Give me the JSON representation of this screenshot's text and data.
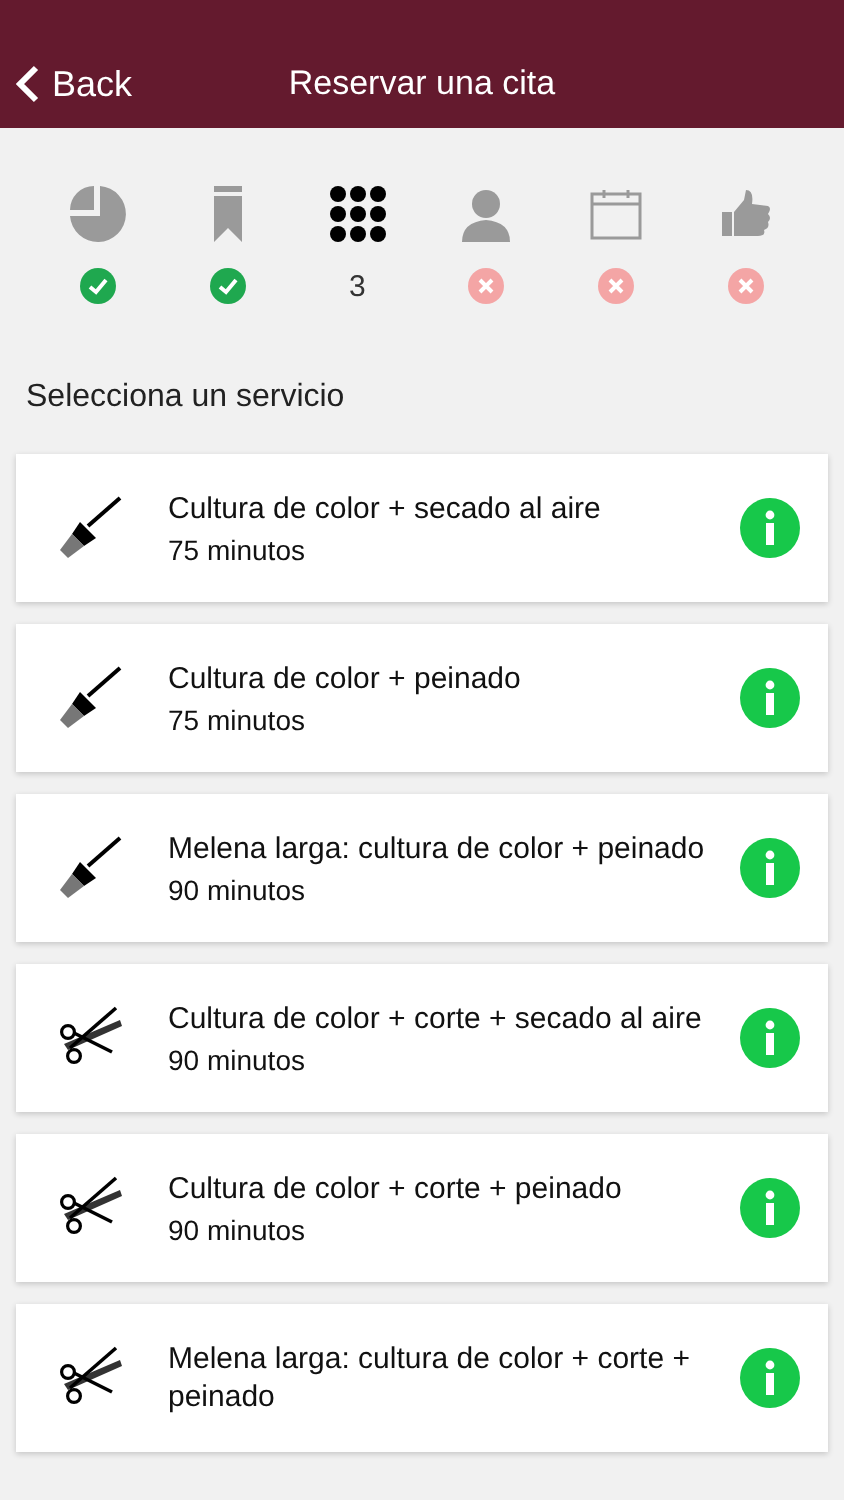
{
  "header": {
    "back": "Back",
    "title": "Reservar una cita"
  },
  "steps": [
    {
      "kind": "pie",
      "completed": true,
      "current": false
    },
    {
      "kind": "bookmark",
      "completed": true,
      "current": false
    },
    {
      "kind": "grid",
      "completed": false,
      "current": true,
      "label": "3"
    },
    {
      "kind": "person",
      "completed": false,
      "current": false
    },
    {
      "kind": "calendar",
      "completed": false,
      "current": false
    },
    {
      "kind": "thumb",
      "completed": false,
      "current": false
    }
  ],
  "section_title": "Selecciona un servicio",
  "services": [
    {
      "kind": "brush",
      "name": "Cultura de color + secado al aire",
      "duration": "75 minutos"
    },
    {
      "kind": "brush",
      "name": "Cultura de color + peinado",
      "duration": "75 minutos"
    },
    {
      "kind": "brush",
      "name": "Melena larga: cultura de color + peinado",
      "duration": "90 minutos"
    },
    {
      "kind": "scissors",
      "name": "Cultura de color + corte + secado al aire",
      "duration": "90 minutos"
    },
    {
      "kind": "scissors",
      "name": "Cultura de color + corte + peinado",
      "duration": "90 minutos"
    },
    {
      "kind": "scissors",
      "name": "Melena larga: cultura de color + corte + peinado"
    }
  ]
}
